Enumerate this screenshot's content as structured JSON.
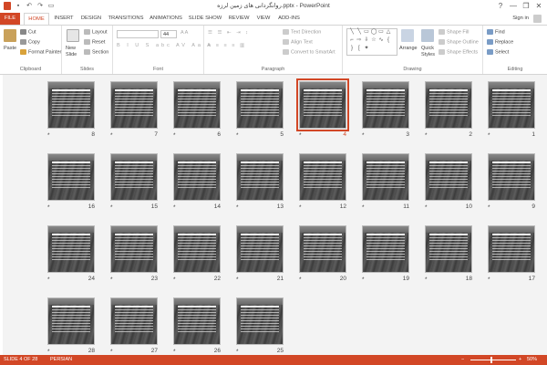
{
  "titlebar": {
    "title": "روانگردانی های زمین لرزه.pptx - PowerPoint",
    "help": "?",
    "minimize": "—",
    "restore": "❐",
    "close": "✕"
  },
  "tabs": [
    "FILE",
    "HOME",
    "INSERT",
    "DESIGN",
    "TRANSITIONS",
    "ANIMATIONS",
    "SLIDE SHOW",
    "REVIEW",
    "VIEW",
    "ADD-INS"
  ],
  "signin": "Sign in",
  "ribbon": {
    "clipboard": {
      "label": "Clipboard",
      "paste": "Paste",
      "cut": "Cut",
      "copy": "Copy",
      "format_painter": "Format Painter"
    },
    "slides": {
      "label": "Slides",
      "new_slide": "New",
      "new_slide2": "Slide",
      "layout": "Layout",
      "reset": "Reset",
      "section": "Section"
    },
    "font": {
      "label": "Font",
      "size": "44"
    },
    "paragraph": {
      "label": "Paragraph",
      "text_direction": "Text Direction",
      "align_text": "Align Text",
      "convert_smartart": "Convert to SmartArt"
    },
    "drawing": {
      "label": "Drawing",
      "arrange": "Arrange",
      "quick_styles": "Quick",
      "quick_styles2": "Styles",
      "shape_fill": "Shape Fill",
      "shape_outline": "Shape Outline",
      "shape_effects": "Shape Effects"
    },
    "editing": {
      "label": "Editing",
      "find": "Find",
      "replace": "Replace",
      "select": "Select"
    }
  },
  "slides": [
    {
      "n": "8"
    },
    {
      "n": "7"
    },
    {
      "n": "6"
    },
    {
      "n": "5"
    },
    {
      "n": "4"
    },
    {
      "n": "3"
    },
    {
      "n": "2"
    },
    {
      "n": "1"
    },
    {
      "n": "16"
    },
    {
      "n": "15"
    },
    {
      "n": "14"
    },
    {
      "n": "13"
    },
    {
      "n": "12"
    },
    {
      "n": "11"
    },
    {
      "n": "10"
    },
    {
      "n": "9"
    },
    {
      "n": "24"
    },
    {
      "n": "23"
    },
    {
      "n": "22"
    },
    {
      "n": "21"
    },
    {
      "n": "20"
    },
    {
      "n": "19"
    },
    {
      "n": "18"
    },
    {
      "n": "17"
    },
    {
      "n": "28"
    },
    {
      "n": "27"
    },
    {
      "n": "26"
    },
    {
      "n": "25"
    }
  ],
  "star": "*",
  "status": {
    "slide": "SLIDE 4 OF 28",
    "language": "PERSIAN",
    "zoom": "50%"
  }
}
